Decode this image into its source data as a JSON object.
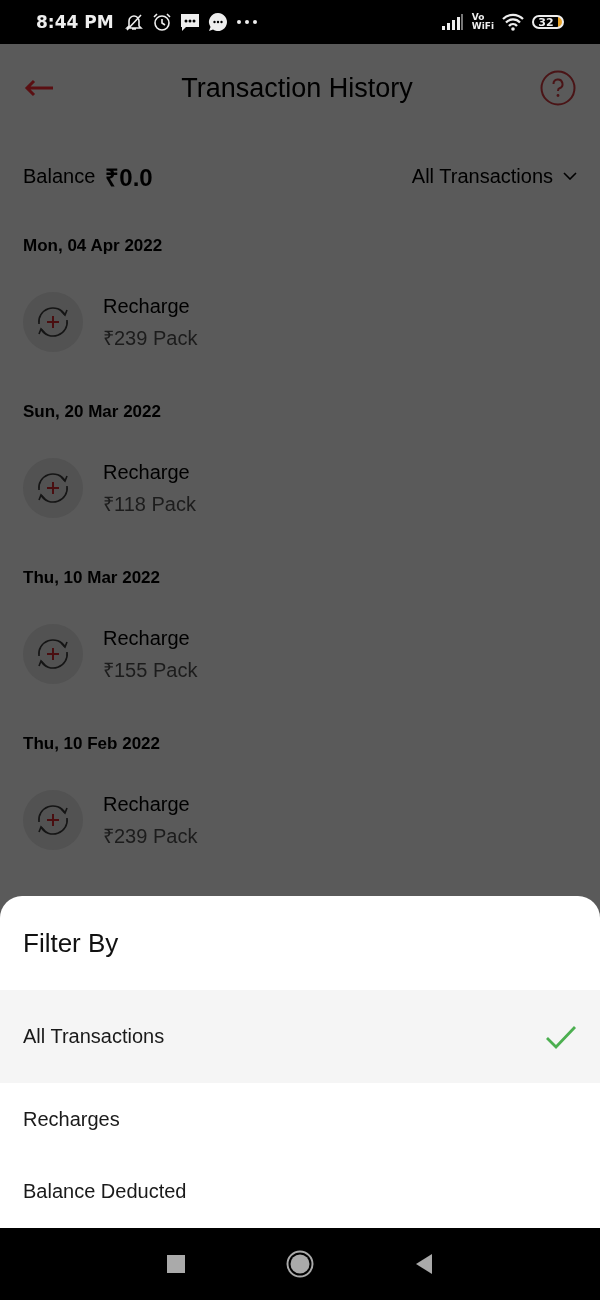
{
  "status_bar": {
    "time": "8:44 PM",
    "network_label": [
      "Vo",
      "WiFi"
    ],
    "battery": "32"
  },
  "header": {
    "title": "Transaction History"
  },
  "balance": {
    "label": "Balance",
    "amount": "₹0.0"
  },
  "filter_dropdown": {
    "label": "All Transactions"
  },
  "groups": [
    {
      "date": "Mon, 04 Apr 2022",
      "transactions": [
        {
          "title": "Recharge",
          "subtitle": "₹239 Pack"
        }
      ]
    },
    {
      "date": "Sun, 20 Mar 2022",
      "transactions": [
        {
          "title": "Recharge",
          "subtitle": "₹118 Pack"
        }
      ]
    },
    {
      "date": "Thu, 10 Mar 2022",
      "transactions": [
        {
          "title": "Recharge",
          "subtitle": "₹155 Pack"
        }
      ]
    },
    {
      "date": "Thu, 10 Feb 2022",
      "transactions": [
        {
          "title": "Recharge",
          "subtitle": "₹239 Pack"
        }
      ]
    }
  ],
  "sheet": {
    "title": "Filter By",
    "options": [
      {
        "label": "All Transactions",
        "selected": true
      },
      {
        "label": "Recharges",
        "selected": false
      },
      {
        "label": "Balance Deducted",
        "selected": false
      }
    ]
  }
}
